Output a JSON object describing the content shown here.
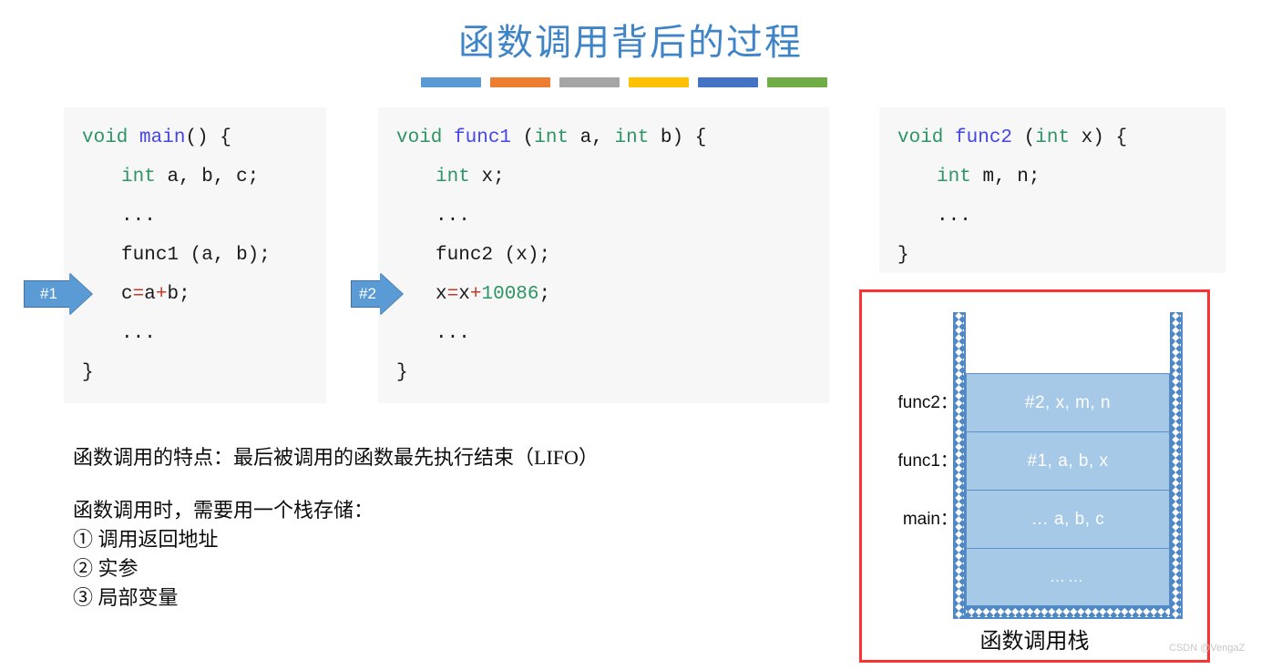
{
  "slide": {
    "title": "函数调用背后的过程",
    "accent_bar_colors": [
      "#5b9bd5",
      "#ed7d31",
      "#a5a5a5",
      "#ffc000",
      "#4472c4",
      "#70ad47"
    ]
  },
  "code_blocks": [
    {
      "id": "main",
      "lines": [
        {
          "segments": [
            {
              "t": "void ",
              "c": "kw"
            },
            {
              "t": "main",
              "c": "fn"
            },
            {
              "t": "() {",
              "c": ""
            }
          ],
          "indent": false
        },
        {
          "segments": [
            {
              "t": "int ",
              "c": "kw"
            },
            {
              "t": "a, b, c;",
              "c": ""
            }
          ],
          "indent": true
        },
        {
          "segments": [
            {
              "t": "...",
              "c": ""
            }
          ],
          "indent": true
        },
        {
          "segments": [
            {
              "t": "func1 (a, b);",
              "c": ""
            }
          ],
          "indent": true
        },
        {
          "segments": [
            {
              "t": "c",
              "c": ""
            },
            {
              "t": "=",
              "c": "op"
            },
            {
              "t": "a",
              "c": ""
            },
            {
              "t": "+",
              "c": "op"
            },
            {
              "t": "b;",
              "c": ""
            }
          ],
          "indent": true
        },
        {
          "segments": [
            {
              "t": "...",
              "c": ""
            }
          ],
          "indent": true
        },
        {
          "segments": [
            {
              "t": "}",
              "c": ""
            }
          ],
          "indent": false
        }
      ]
    },
    {
      "id": "func1",
      "lines": [
        {
          "segments": [
            {
              "t": "void ",
              "c": "kw"
            },
            {
              "t": "func1",
              "c": "fn"
            },
            {
              "t": " (",
              "c": ""
            },
            {
              "t": "int ",
              "c": "kw"
            },
            {
              "t": "a, ",
              "c": ""
            },
            {
              "t": "int ",
              "c": "kw"
            },
            {
              "t": "b) {",
              "c": ""
            }
          ],
          "indent": false
        },
        {
          "segments": [
            {
              "t": "int ",
              "c": "kw"
            },
            {
              "t": "x;",
              "c": ""
            }
          ],
          "indent": true
        },
        {
          "segments": [
            {
              "t": "...",
              "c": ""
            }
          ],
          "indent": true
        },
        {
          "segments": [
            {
              "t": "func2 (x);",
              "c": ""
            }
          ],
          "indent": true
        },
        {
          "segments": [
            {
              "t": "x",
              "c": ""
            },
            {
              "t": "=",
              "c": "op"
            },
            {
              "t": "x",
              "c": ""
            },
            {
              "t": "+",
              "c": "op"
            },
            {
              "t": "10086",
              "c": "num"
            },
            {
              "t": ";",
              "c": ""
            }
          ],
          "indent": true
        },
        {
          "segments": [
            {
              "t": "...",
              "c": ""
            }
          ],
          "indent": true
        },
        {
          "segments": [
            {
              "t": "}",
              "c": ""
            }
          ],
          "indent": false
        }
      ]
    },
    {
      "id": "func2",
      "lines": [
        {
          "segments": [
            {
              "t": "void ",
              "c": "kw"
            },
            {
              "t": "func2",
              "c": "fn"
            },
            {
              "t": " (",
              "c": ""
            },
            {
              "t": "int ",
              "c": "kw"
            },
            {
              "t": "x) {",
              "c": ""
            }
          ],
          "indent": false
        },
        {
          "segments": [
            {
              "t": "int ",
              "c": "kw"
            },
            {
              "t": "m, n;",
              "c": ""
            }
          ],
          "indent": true
        },
        {
          "segments": [
            {
              "t": "...",
              "c": ""
            }
          ],
          "indent": true
        },
        {
          "segments": [
            {
              "t": "}",
              "c": ""
            }
          ],
          "indent": false
        }
      ]
    }
  ],
  "arrows": [
    {
      "label": "#1"
    },
    {
      "label": "#2"
    }
  ],
  "notes": {
    "line1": "函数调用的特点：最后被调用的函数最先执行结束（LIFO）",
    "line2": "函数调用时，需要用一个栈存储：",
    "item1": "① 调用返回地址",
    "item2": "② 实参",
    "item3": "③ 局部变量"
  },
  "stack_diagram": {
    "caption": "函数调用栈",
    "labels": [
      "func2：",
      "func1：",
      "main："
    ],
    "cells": [
      {
        "text": "#2, x, m, n"
      },
      {
        "text": "#1, a, b, x"
      },
      {
        "text": "… a, b, c"
      },
      {
        "text": "……"
      }
    ],
    "border_color": "#fa3232",
    "cell_fill": "#a6c9e8"
  },
  "watermark": "CSDN @VengaZ"
}
